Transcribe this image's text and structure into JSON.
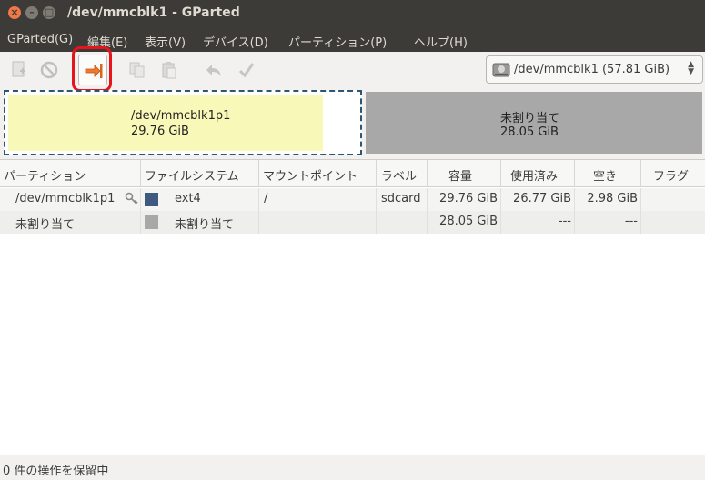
{
  "window": {
    "title": "/dev/mmcblk1 - GParted"
  },
  "menubar": {
    "items": [
      {
        "label": "GParted(G)"
      },
      {
        "label": "編集(E)"
      },
      {
        "label": "表示(V)"
      },
      {
        "label": "デバイス(D)"
      },
      {
        "label": "パーティション(P)"
      },
      {
        "label": "ヘルプ(H)"
      }
    ]
  },
  "toolbar": {
    "buttons": [
      {
        "icon": "new-partition-icon",
        "enabled": false
      },
      {
        "icon": "delete-icon",
        "enabled": false
      },
      {
        "icon": "resize-move-icon",
        "enabled": true,
        "highlighted": true
      },
      {
        "icon": "copy-icon",
        "enabled": false
      },
      {
        "icon": "paste-icon",
        "enabled": false
      },
      {
        "icon": "undo-icon",
        "enabled": false
      },
      {
        "icon": "apply-icon",
        "enabled": false
      }
    ],
    "device_selector": {
      "device": "/dev/mmcblk1",
      "size": "(57.81 GiB)"
    }
  },
  "partition_map": {
    "partitions": [
      {
        "name": "/dev/mmcblk1p1",
        "size": "29.76 GiB",
        "used_fraction": 0.9,
        "color": "#f8f8b8"
      },
      {
        "name": "未割り当て",
        "size": "28.05 GiB",
        "color": "#a8a8a8"
      }
    ]
  },
  "table": {
    "columns": [
      "パーティション",
      "ファイルシステム",
      "マウントポイント",
      "ラベル",
      "容量",
      "使用済み",
      "空き",
      "フラグ"
    ],
    "rows": [
      {
        "partition": "/dev/mmcblk1p1",
        "fs": "ext4",
        "fs_color": "#3e5a7e",
        "mount": "/",
        "label": "sdcard",
        "size": "29.76 GiB",
        "used": "26.77 GiB",
        "free": "2.98 GiB",
        "flags": ""
      },
      {
        "partition": "未割り当て",
        "fs": "未割り当て",
        "fs_color": "#a8a8a8",
        "mount": "",
        "label": "",
        "size": "28.05 GiB",
        "used": "---",
        "free": "---",
        "flags": ""
      }
    ]
  },
  "statusbar": {
    "text": "0 件の操作を保留中"
  }
}
